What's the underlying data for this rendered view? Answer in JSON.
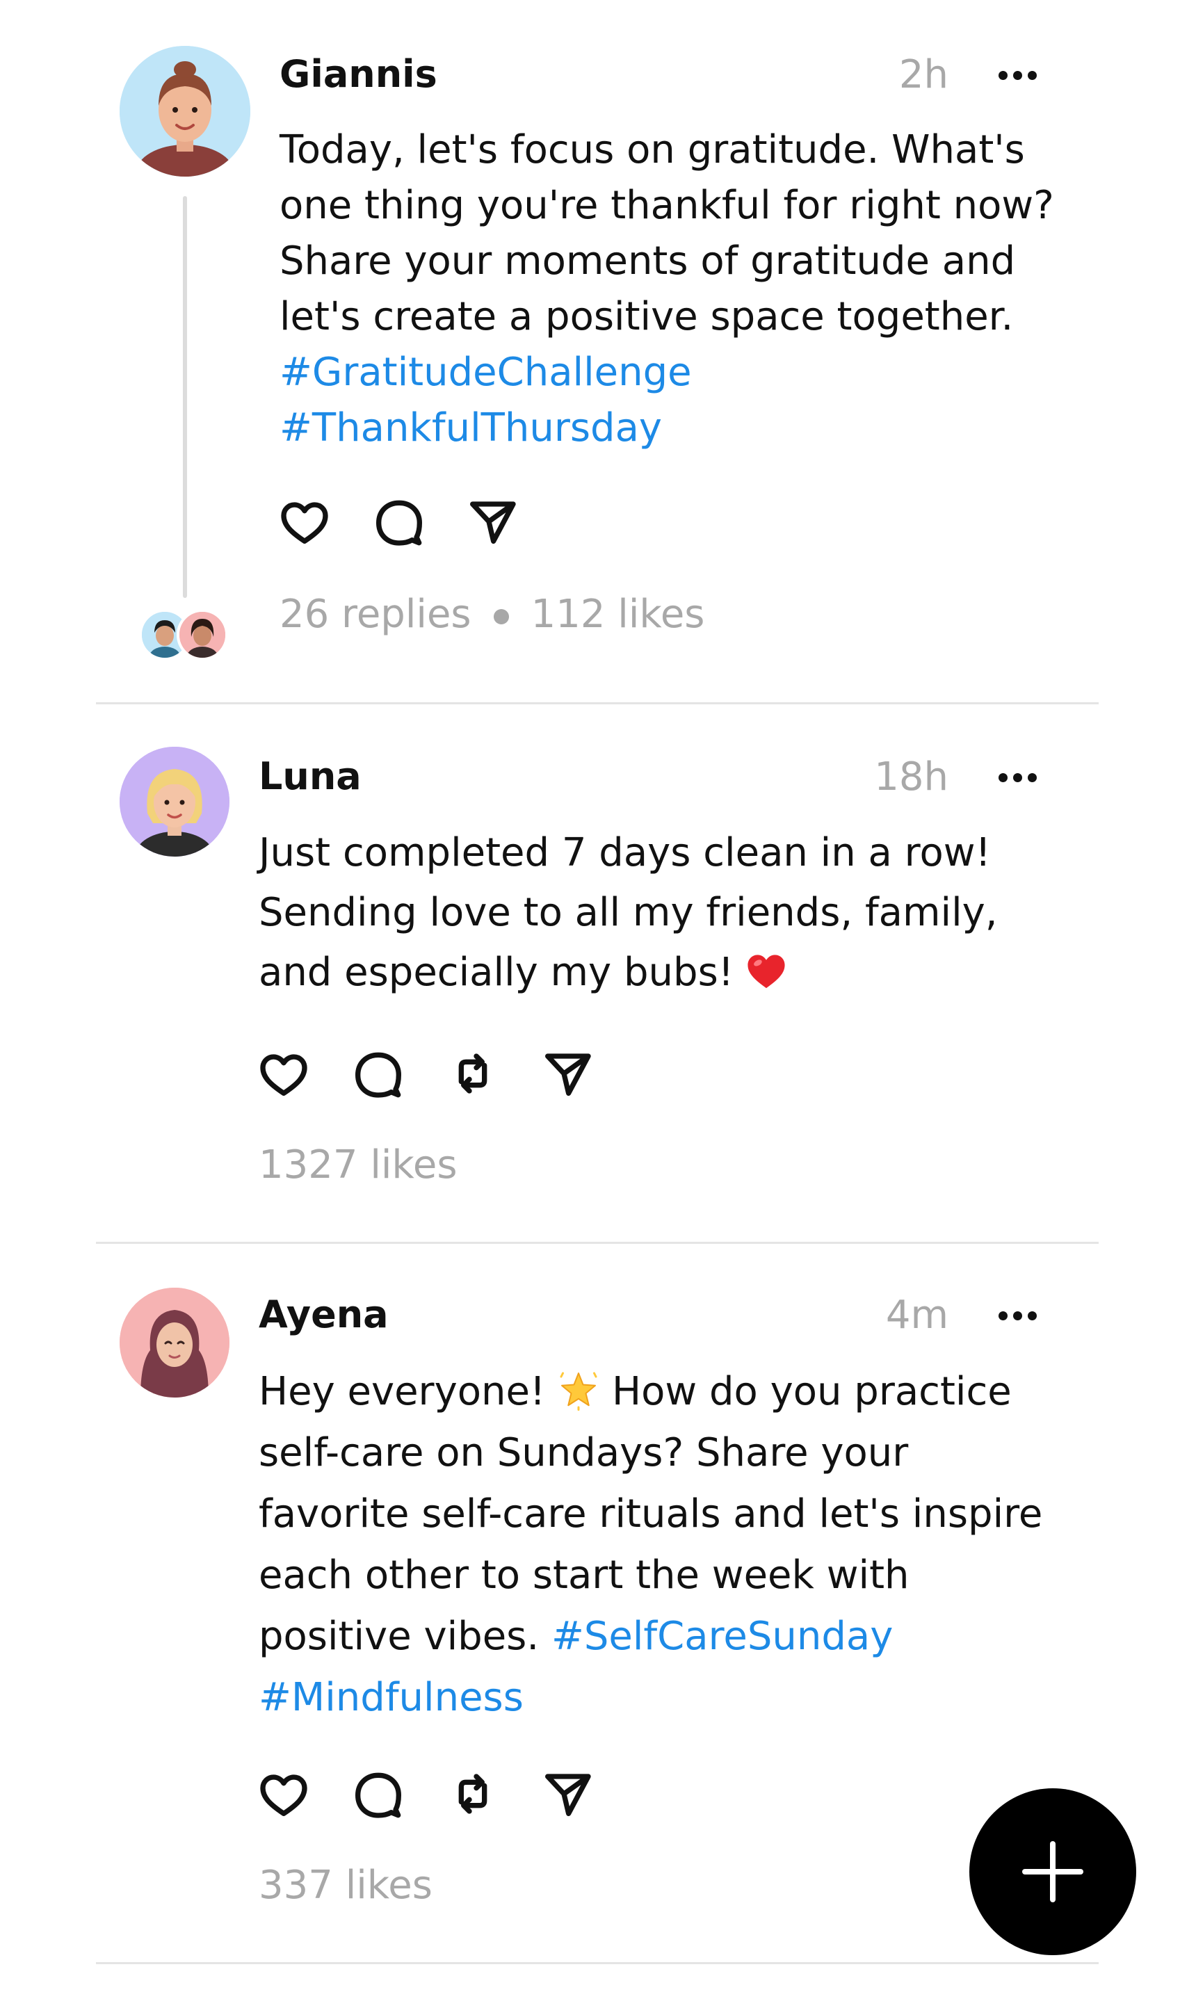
{
  "colors": {
    "text": "#111111",
    "muted": "#a8a8a8",
    "hashtag": "#1d8ae6",
    "divider": "#e4e4e4",
    "fab_background": "#000000"
  },
  "posts": [
    {
      "author": "Giannis",
      "time": "2h",
      "avatar_icon": "avatar-man-bun-icon",
      "avatar_bg": "#bfe5f8",
      "lines": [
        "Today, let's focus on gratitude. What's",
        "one thing you're thankful for right now?",
        "Share your moments of gratitude and",
        "let's create a positive space together."
      ],
      "hashtags": [
        "#GratitudeChallenge",
        "#ThankfulThursday"
      ],
      "actions": [
        "like-icon",
        "comment-icon",
        "share-icon"
      ],
      "replies": "26 replies",
      "likes": "112 likes"
    },
    {
      "author": "Luna",
      "time": "18h",
      "avatar_icon": "avatar-blonde-woman-icon",
      "avatar_bg": "#c8b2f5",
      "lines": [
        "Just completed 7 days clean in a row!",
        "Sending love to all my friends, family,",
        "and especially my bubs!"
      ],
      "emoji": "red-heart-emoji",
      "actions": [
        "like-icon",
        "comment-icon",
        "repost-icon",
        "share-icon"
      ],
      "likes": "1327 likes"
    },
    {
      "author": "Ayena",
      "time": "4m",
      "avatar_icon": "avatar-hijab-woman-icon",
      "avatar_bg": "#f6b3b3",
      "line1_before_emoji": "Hey everyone!",
      "line1_after_emoji": "How do you practice",
      "emoji": "glowing-star-emoji",
      "lines": [
        "self-care on Sundays? Share your",
        "favorite self-care rituals and let's inspire",
        "each other to start the week with"
      ],
      "last_line_text": "positive vibes.",
      "hashtags": [
        "#SelfCareSunday",
        "#Mindfulness"
      ],
      "actions": [
        "like-icon",
        "comment-icon",
        "repost-icon",
        "share-icon"
      ],
      "likes": "337 likes"
    }
  ],
  "fab": {
    "icon": "plus-icon"
  }
}
